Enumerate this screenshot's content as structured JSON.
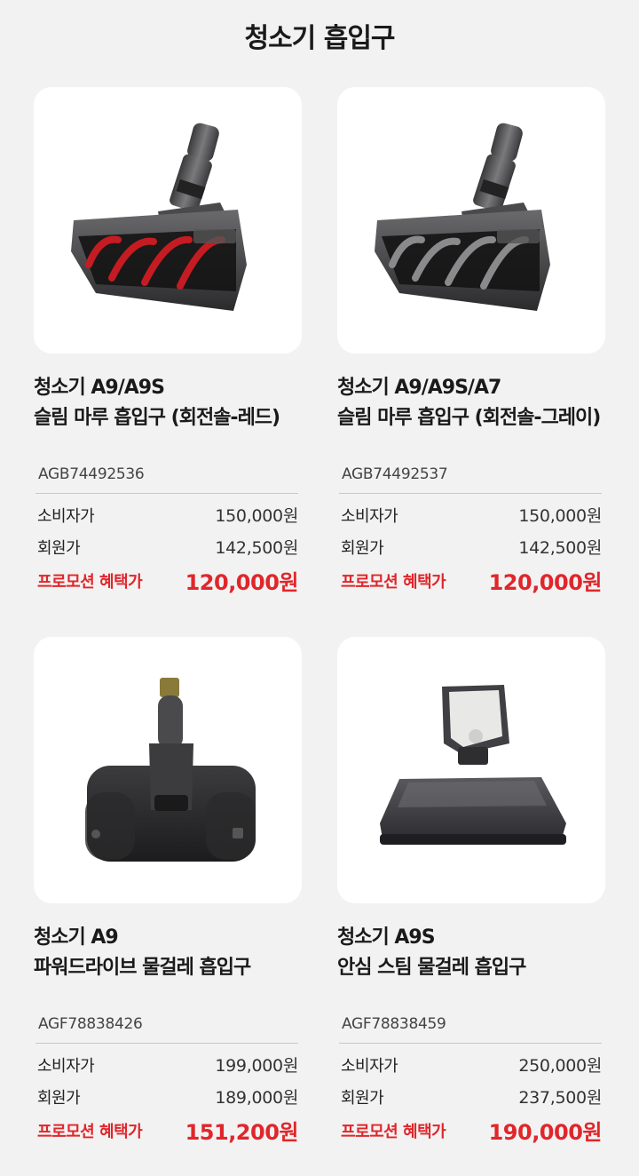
{
  "page": {
    "title": "청소기 흡입구"
  },
  "labels": {
    "consumer": "소비자가",
    "member": "회원가",
    "promo": "프로모션 혜택가"
  },
  "products": [
    {
      "name_line1": "청소기 A9/A9S",
      "name_line2": "슬림 마루 흡입구 (회전솔-레드)",
      "sku": "AGB74492536",
      "consumer_price": "150,000원",
      "member_price": "142,500원",
      "promo_price": "120,000원",
      "image_icon": "vacuum-slim-floor-nozzle-red-icon"
    },
    {
      "name_line1": "청소기 A9/A9S/A7",
      "name_line2": "슬림 마루 흡입구 (회전솔-그레이)",
      "sku": "AGB74492537",
      "consumer_price": "150,000원",
      "member_price": "142,500원",
      "promo_price": "120,000원",
      "image_icon": "vacuum-slim-floor-nozzle-gray-icon"
    },
    {
      "name_line1": "청소기 A9",
      "name_line2": "파워드라이브 물걸레 흡입구",
      "sku": "AGF78838426",
      "consumer_price": "199,000원",
      "member_price": "189,000원",
      "promo_price": "151,200원",
      "image_icon": "vacuum-power-drive-mop-nozzle-icon"
    },
    {
      "name_line1": "청소기 A9S",
      "name_line2": "안심 스팀 물걸레 흡입구",
      "sku": "AGF78838459",
      "consumer_price": "250,000원",
      "member_price": "237,500원",
      "promo_price": "190,000원",
      "image_icon": "vacuum-steam-mop-nozzle-icon"
    }
  ],
  "colors": {
    "promo": "#e0262b",
    "background": "#f2f2f2",
    "card": "#ffffff"
  }
}
